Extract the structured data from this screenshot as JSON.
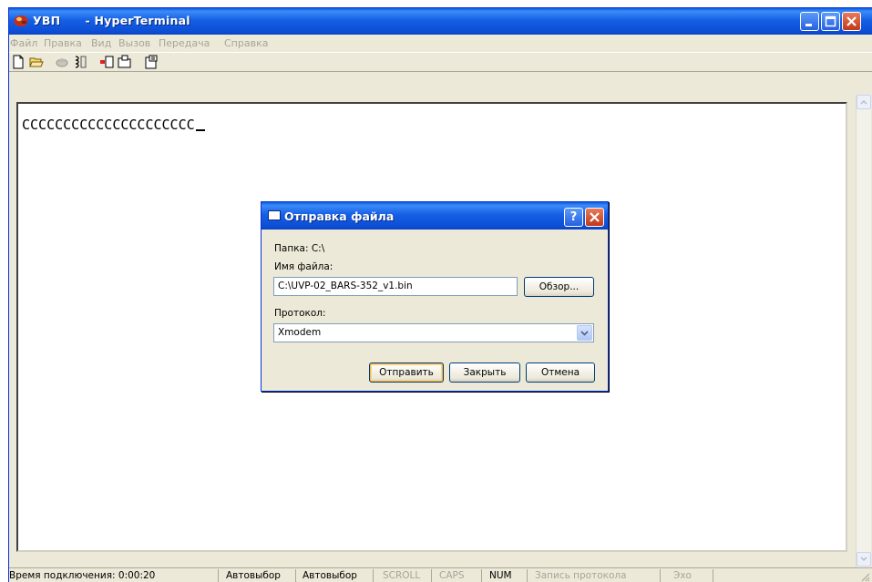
{
  "window": {
    "title": "УВП      - HyperTerminal"
  },
  "menu": [
    "Файл",
    "Правка",
    "Вид",
    "Вызов",
    "Передача",
    "Справка"
  ],
  "toolbar": {
    "icons": [
      "new-icon",
      "open-icon",
      "disconnect-icon",
      "dial-icon",
      "send-icon",
      "receive-icon",
      "properties-icon"
    ]
  },
  "terminal": {
    "text": "CCCCCCCCCCCCCCCCCCCCC"
  },
  "statusbar": {
    "connect_time": "Время подключения: 0:00:20",
    "autodetect1": "Автовыбор",
    "autodetect2": "Автовыбор",
    "scroll": "SCROLL",
    "caps": "CAPS",
    "num": "NUM",
    "capture": "Запись протокола",
    "echo": "Эхо"
  },
  "dialog": {
    "title": "Отправка файла",
    "folder_label": "Папка: C:\\",
    "filename_label": "Имя файла:",
    "filename_value": "C:\\UVP-02_BARS-352_v1.bin",
    "browse_label": "Обзор...",
    "protocol_label": "Протокол:",
    "protocol_value": "Xmodem",
    "send_label": "Отправить",
    "close_label": "Закрыть",
    "cancel_label": "Отмена",
    "help_label": "?"
  },
  "colors": {
    "titlebar": "#0a5fe0",
    "window_bg": "#ece9d8",
    "close_button": "#c1391a",
    "menu_disabled_text": "#a7a59b"
  }
}
